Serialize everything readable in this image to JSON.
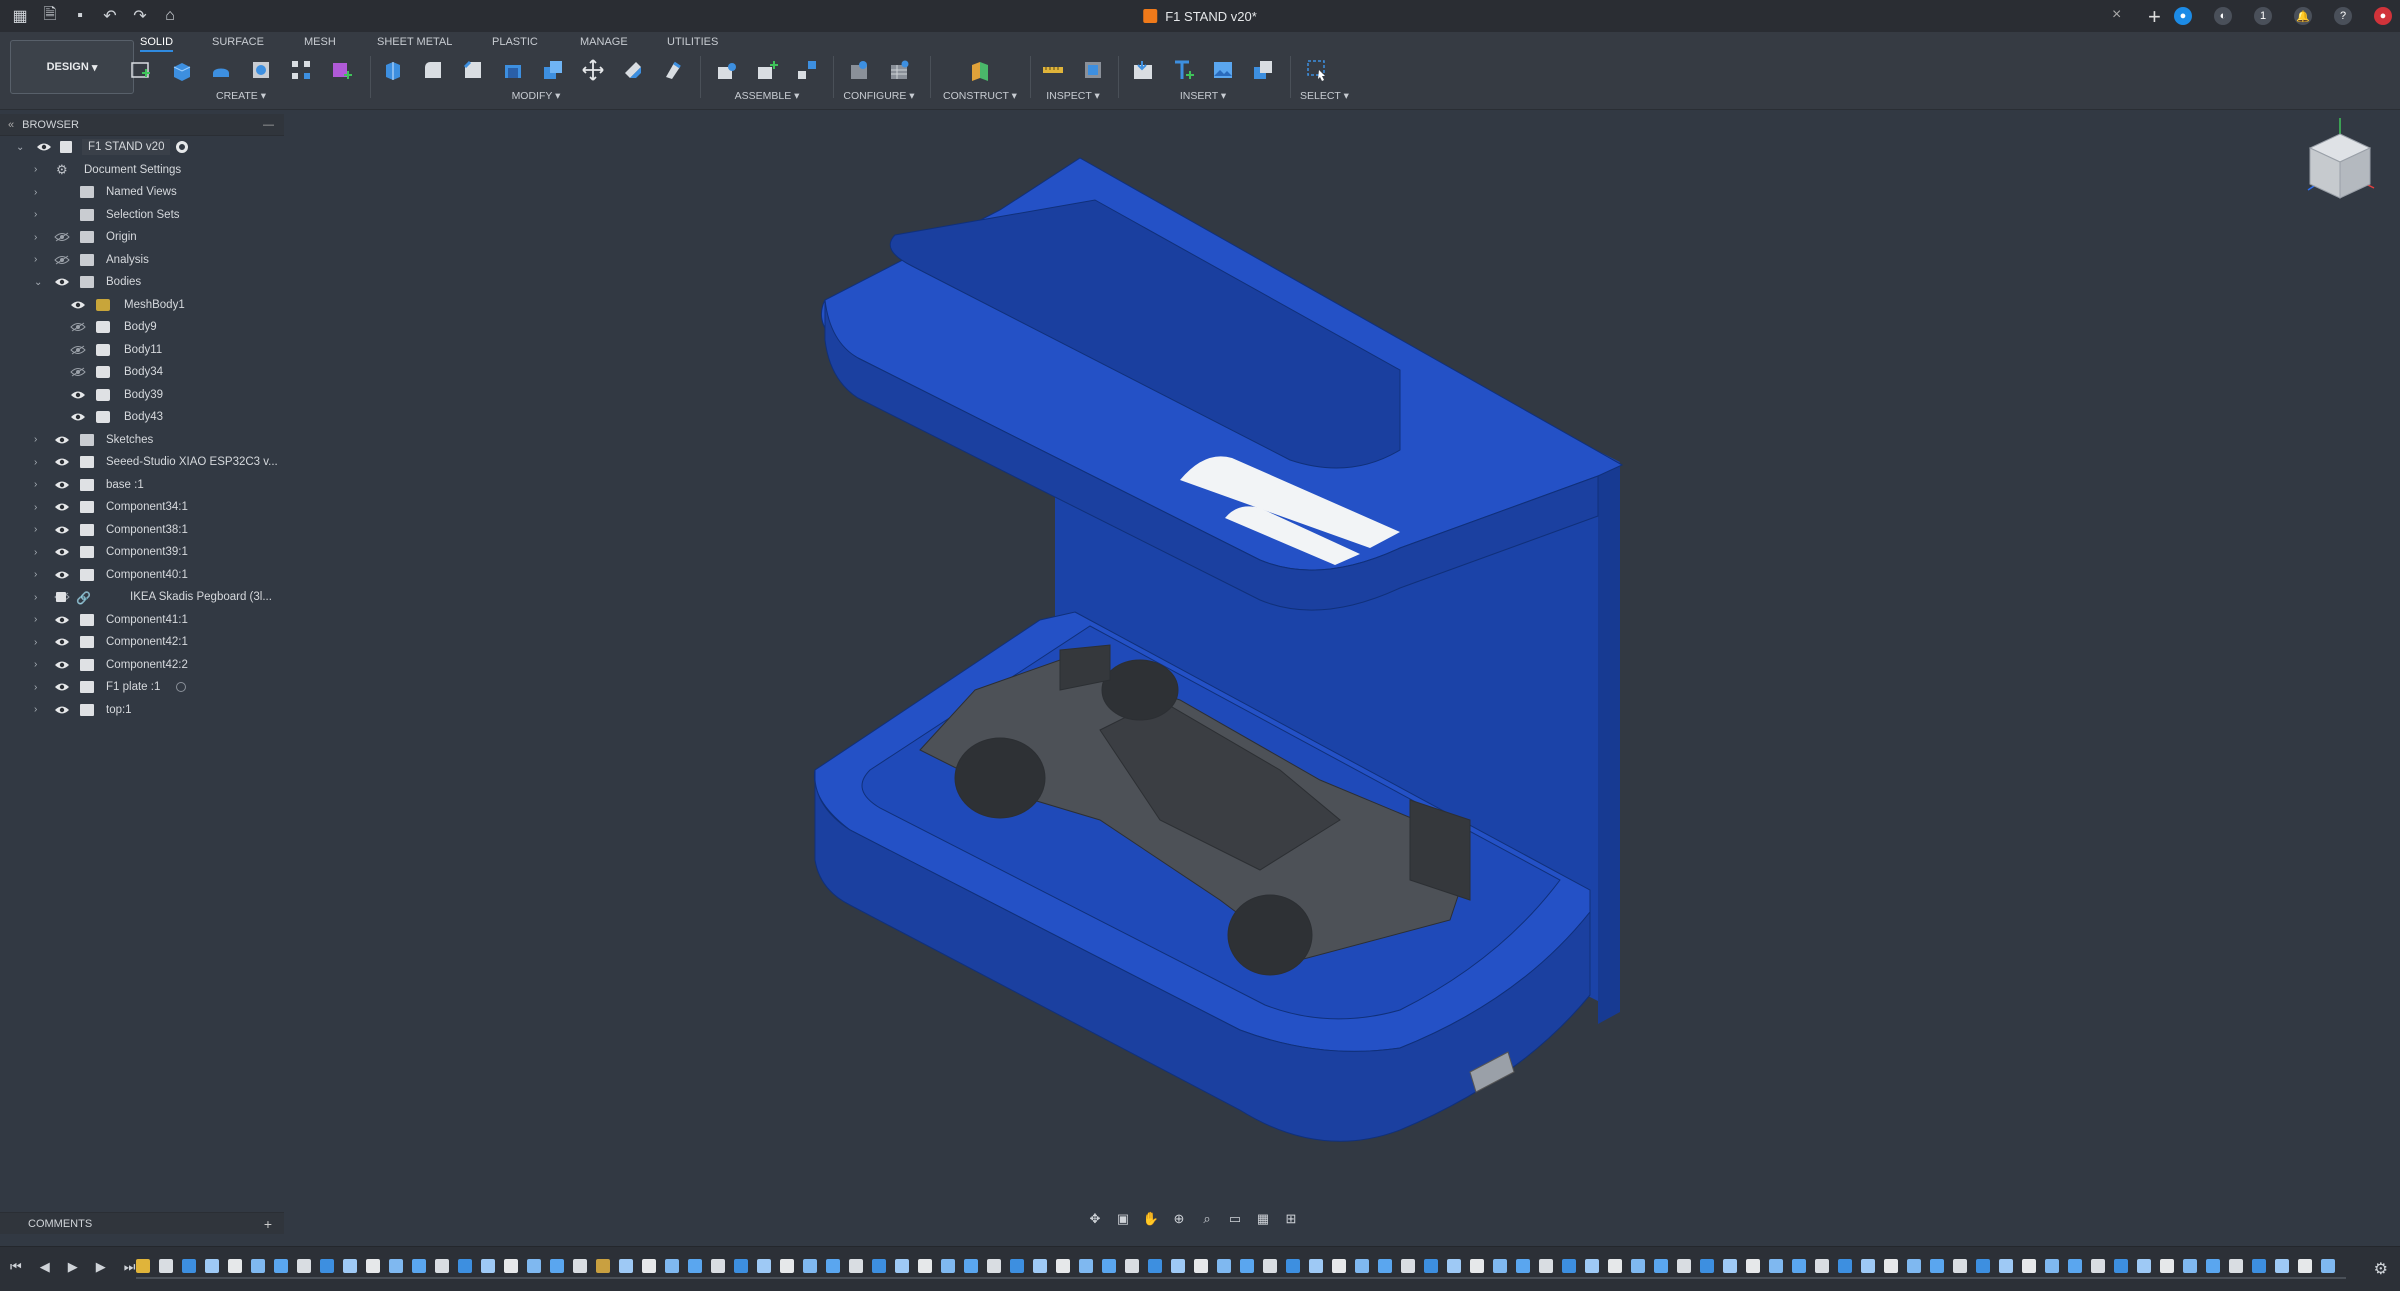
{
  "window": {
    "title": "F1 STAND v20*",
    "notification_count": "1"
  },
  "workspace": {
    "mode_label": "DESIGN"
  },
  "tabs": [
    {
      "label": "SOLID",
      "active": true
    },
    {
      "label": "SURFACE",
      "active": false
    },
    {
      "label": "MESH",
      "active": false
    },
    {
      "label": "SHEET METAL",
      "active": false
    },
    {
      "label": "PLASTIC",
      "active": false
    },
    {
      "label": "MANAGE",
      "active": false
    },
    {
      "label": "UTILITIES",
      "active": false
    }
  ],
  "toolbar_groups": [
    {
      "label": "CREATE",
      "icons": [
        "new-sketch-icon",
        "extrude-icon",
        "revolve-icon",
        "hole-icon",
        "pattern-icon",
        "new-component-icon"
      ]
    },
    {
      "label": "MODIFY",
      "icons": [
        "press-pull-icon",
        "fillet-icon",
        "chamfer-icon",
        "shell-icon",
        "combine-icon",
        "move-icon",
        "split-face-icon",
        "align-icon"
      ]
    },
    {
      "label": "ASSEMBLE",
      "icons": [
        "joint-icon",
        "new-component-assemble-icon",
        "as-built-joint-icon"
      ]
    },
    {
      "label": "CONFIGURE",
      "icons": [
        "configure-table-icon",
        "configure-rules-icon"
      ]
    },
    {
      "label": "CONSTRUCT",
      "icons": [
        "plane-icon"
      ]
    },
    {
      "label": "INSPECT",
      "icons": [
        "measure-icon",
        "section-analysis-icon"
      ]
    },
    {
      "label": "INSERT",
      "icons": [
        "insert-svg-icon",
        "insert-text-icon",
        "insert-canvas-icon",
        "insert-mesh-icon"
      ]
    },
    {
      "label": "SELECT",
      "icons": [
        "select-window-icon"
      ]
    }
  ],
  "browser": {
    "title": "BROWSER",
    "root": "F1 STAND v20",
    "items": [
      {
        "label": "Document Settings",
        "kind": "gear"
      },
      {
        "label": "Named Views",
        "kind": "folder"
      },
      {
        "label": "Selection Sets",
        "kind": "folder"
      },
      {
        "label": "Origin",
        "kind": "folder",
        "hidden": true
      },
      {
        "label": "Analysis",
        "kind": "folder",
        "hidden": true
      },
      {
        "label": "Bodies",
        "kind": "folder",
        "expanded": true
      },
      {
        "label": "MeshBody1",
        "kind": "mesh",
        "child": true
      },
      {
        "label": "Body9",
        "kind": "body",
        "child": true,
        "hidden": true
      },
      {
        "label": "Body11",
        "kind": "body",
        "child": true,
        "hidden": true
      },
      {
        "label": "Body34",
        "kind": "body",
        "child": true,
        "hidden": true
      },
      {
        "label": "Body39",
        "kind": "body",
        "child": true
      },
      {
        "label": "Body43",
        "kind": "body",
        "child": true
      },
      {
        "label": "Sketches",
        "kind": "folder"
      },
      {
        "label": "Seeed-Studio XIAO ESP32C3 v...",
        "kind": "component"
      },
      {
        "label": "base :1",
        "kind": "component"
      },
      {
        "label": "Component34:1",
        "kind": "component"
      },
      {
        "label": "Component38:1",
        "kind": "component"
      },
      {
        "label": "Component39:1",
        "kind": "component"
      },
      {
        "label": "Component40:1",
        "kind": "component"
      },
      {
        "label": "IKEA Skadis Pegboard (3l...",
        "kind": "linked",
        "hidden": true
      },
      {
        "label": "Component41:1",
        "kind": "component"
      },
      {
        "label": "Component42:1",
        "kind": "component"
      },
      {
        "label": "Component42:2",
        "kind": "component"
      },
      {
        "label": "F1 plate :1",
        "kind": "component"
      },
      {
        "label": "top:1",
        "kind": "component"
      }
    ]
  },
  "comments": {
    "title": "COMMENTS"
  },
  "colors": {
    "model_blue": "#1f49b8",
    "model_blue_dark": "#15358c",
    "accent": "#2f8ae0"
  }
}
